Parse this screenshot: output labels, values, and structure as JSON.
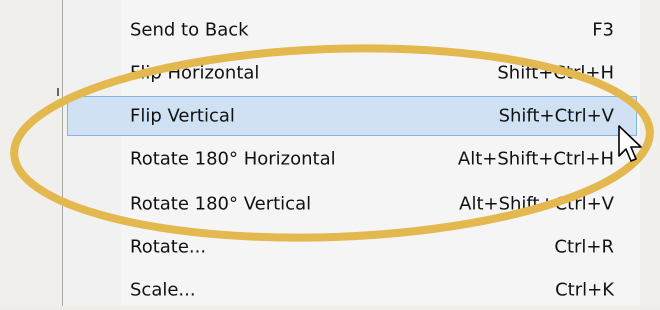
{
  "menu": {
    "items": [
      {
        "label": "Send to Back",
        "shortcut": "F3"
      },
      {
        "label": "Flip Horizontal",
        "shortcut": "Shift+Ctrl+H"
      },
      {
        "label": "Flip Vertical",
        "shortcut": "Shift+Ctrl+V"
      },
      {
        "label": "Rotate 180° Horizontal",
        "shortcut": "Alt+Shift+Ctrl+H"
      },
      {
        "label": "Rotate 180° Vertical",
        "shortcut": "Alt+Shift+Ctrl+V"
      },
      {
        "label": "Rotate...",
        "shortcut": "Ctrl+R"
      },
      {
        "label": "Scale...",
        "shortcut": "Ctrl+K"
      }
    ],
    "highlighted_index": 2
  },
  "colors": {
    "highlight_fill": "#cfe1f3",
    "highlight_border": "#85b4e4",
    "annotation_ellipse": "#e3b84f"
  },
  "icons": {
    "cursor": "pointer-arrow-icon"
  }
}
